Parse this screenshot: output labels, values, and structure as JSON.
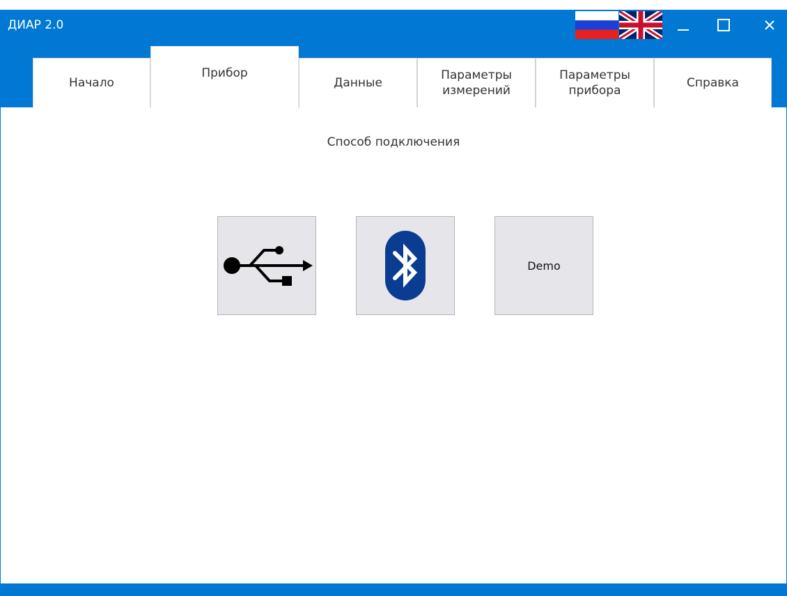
{
  "window": {
    "title": "ДИАР 2.0",
    "accent_color": "#0078d4"
  },
  "language_flags": [
    {
      "icon": "russia-flag-icon"
    },
    {
      "icon": "uk-flag-icon"
    }
  ],
  "window_controls": {
    "minimize_icon": "minimize-icon",
    "maximize_icon": "maximize-icon",
    "close_icon": "close-icon"
  },
  "tabs": [
    {
      "label": "Начало"
    },
    {
      "label": "Прибор",
      "active": true
    },
    {
      "label": "Данные"
    },
    {
      "label": "Параметры\nизмерений"
    },
    {
      "label": "Параметры\nприбора"
    },
    {
      "label": "Справка"
    }
  ],
  "main": {
    "section_title": "Способ подключения",
    "connection_buttons": [
      {
        "icon": "usb-icon"
      },
      {
        "icon": "bluetooth-icon"
      },
      {
        "label": "Demo"
      }
    ]
  }
}
